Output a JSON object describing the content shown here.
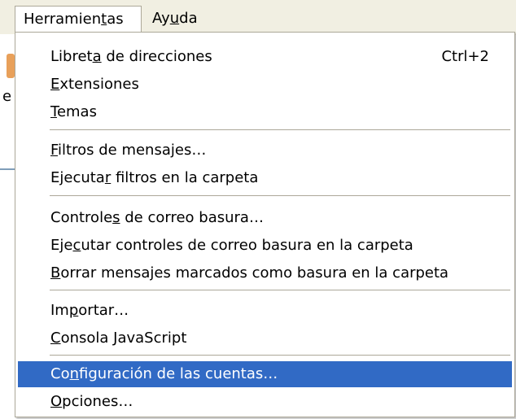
{
  "menubar": {
    "herramientas": {
      "before": "Herramien",
      "accel": "t",
      "after": "as"
    },
    "ayuda": {
      "before": "Ay",
      "accel": "u",
      "after": "da"
    }
  },
  "menu": {
    "items": [
      {
        "before": "Libret",
        "accel": "a",
        "after": " de direcciones",
        "shortcut": "Ctrl+2"
      },
      {
        "before": "",
        "accel": "E",
        "after": "xtensiones"
      },
      {
        "before": "",
        "accel": "T",
        "after": "emas"
      },
      {
        "before": "",
        "accel": "F",
        "after": "iltros de mensajes…"
      },
      {
        "before": "Ejecuta",
        "accel": "r",
        "after": " filtros en la carpeta"
      },
      {
        "before": "Controle",
        "accel": "s",
        "after": " de correo basura…"
      },
      {
        "before": "Eje",
        "accel": "c",
        "after": "utar controles de correo basura en la carpeta"
      },
      {
        "before": "",
        "accel": "B",
        "after": "orrar mensajes marcados como basura en la carpeta"
      },
      {
        "before": "Im",
        "accel": "p",
        "after": "ortar…"
      },
      {
        "before": "",
        "accel": "C",
        "after": "onsola JavaScript"
      },
      {
        "before": "Co",
        "accel": "n",
        "after": "figuración de las cuentas…"
      },
      {
        "before": "",
        "accel": "O",
        "after": "pciones…"
      }
    ]
  },
  "background": {
    "letter": "e"
  }
}
